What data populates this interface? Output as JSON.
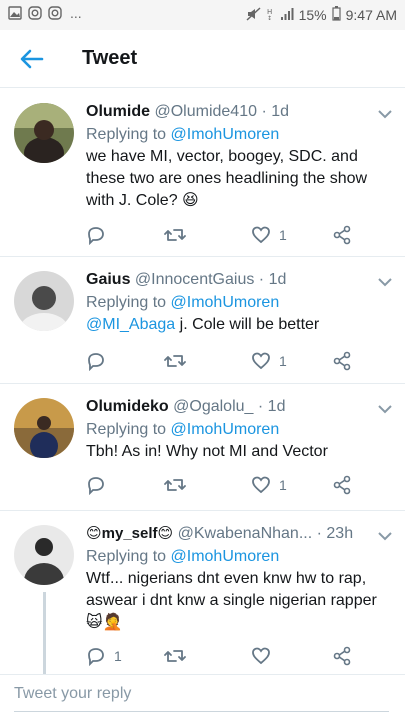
{
  "status_bar": {
    "left_icons": [
      "image-icon",
      "instagram-icon",
      "instagram-icon"
    ],
    "dots": "...",
    "battery": "15%",
    "time": "9:47 AM"
  },
  "app_bar": {
    "title": "Tweet"
  },
  "tweets": [
    {
      "name": "Olumide",
      "handle": "@Olumide410",
      "time": "1d",
      "replying_prefix": "Replying to",
      "replying_to": "@ImohUmoren",
      "text": "we have MI, vector, boogey, SDC. and these two are ones headlining the show with J. Cole? 😆",
      "likes": "1",
      "replies": ""
    },
    {
      "name": "Gaius",
      "handle": "@InnocentGaius",
      "time": "1d",
      "replying_prefix": "Replying to",
      "replying_to": "@ImohUmoren",
      "text_mention": "@MI_Abaga",
      "text": " j. Cole  will be better",
      "likes": "1",
      "replies": ""
    },
    {
      "name": "Olumideko",
      "handle": "@Ogalolu_",
      "time": "1d",
      "replying_prefix": "Replying to",
      "replying_to": "@ImohUmoren",
      "text": "Tbh! As in! Why not MI and Vector",
      "likes": "1",
      "replies": ""
    },
    {
      "name": "😊my_self😊",
      "handle": "@KwabenaNhan...",
      "time": "23h",
      "replying_prefix": "Replying to",
      "replying_to": "@ImohUmoren",
      "text": "Wtf... nigerians dnt even knw hw to rap, aswear i dnt knw a single nigerian rapper 🙀🤦",
      "likes": "",
      "replies": "1"
    }
  ],
  "compose": {
    "placeholder": "Tweet your reply"
  },
  "colors": {
    "accent": "#1b95e0",
    "muted": "#657786",
    "divider": "#e6ecf0"
  }
}
